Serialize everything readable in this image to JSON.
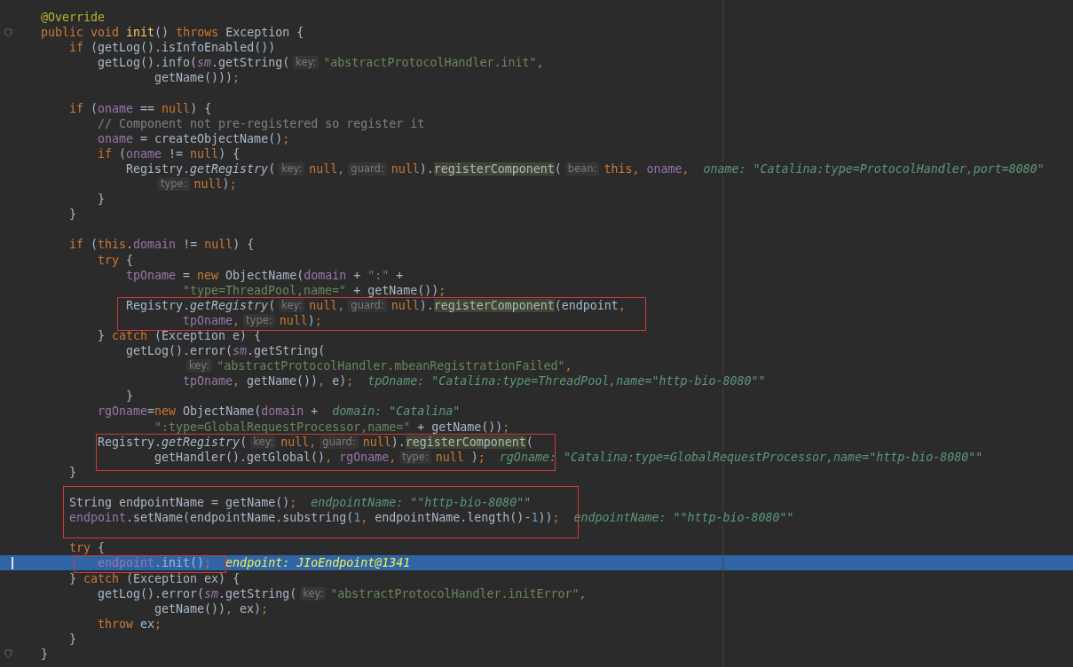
{
  "editor": {
    "lines": [
      {
        "current": false,
        "tokens": [
          {
            "kind": "annotation",
            "text": "@Override"
          }
        ]
      },
      {
        "current": false,
        "fold": true,
        "tokens": [
          {
            "kind": "keyword",
            "text": "public void "
          },
          {
            "kind": "decl",
            "text": "init"
          },
          {
            "kind": "plain",
            "text": "() "
          },
          {
            "kind": "keyword",
            "text": "throws "
          },
          {
            "kind": "plain",
            "text": "Exception {"
          }
        ]
      },
      {
        "current": false,
        "tokens": [
          {
            "kind": "keyword",
            "text": "if"
          },
          {
            "kind": "plain",
            "text": " (getLog().isInfoEnabled())"
          }
        ]
      },
      {
        "current": false,
        "tokens": [
          {
            "kind": "plain",
            "text": "getLog().info("
          },
          {
            "kind": "static_field",
            "text": "sm"
          },
          {
            "kind": "plain",
            "text": ".getString("
          },
          {
            "kind": "hint",
            "text": "key:"
          },
          {
            "kind": "string",
            "text": "\"abstractProtocolHandler.init\""
          },
          {
            "kind": "keyword",
            "text": ","
          }
        ]
      },
      {
        "current": false,
        "tokens": [
          {
            "kind": "plain",
            "text": "getName()))"
          },
          {
            "kind": "keyword",
            "text": ";"
          }
        ]
      },
      {
        "current": false
      },
      {
        "current": false,
        "tokens": [
          {
            "kind": "keyword",
            "text": "if"
          },
          {
            "kind": "plain",
            "text": " ("
          },
          {
            "kind": "field",
            "text": "oname"
          },
          {
            "kind": "plain",
            "text": " == "
          },
          {
            "kind": "keyword",
            "text": "null"
          },
          {
            "kind": "plain",
            "text": ") {"
          }
        ]
      },
      {
        "current": false,
        "tokens": [
          {
            "kind": "comment",
            "text": "// Component not pre-registered so register it"
          }
        ]
      },
      {
        "current": false,
        "tokens": [
          {
            "kind": "field",
            "text": "oname"
          },
          {
            "kind": "plain",
            "text": " = createObjectName()"
          },
          {
            "kind": "keyword",
            "text": ";"
          }
        ]
      },
      {
        "current": false,
        "tokens": [
          {
            "kind": "keyword",
            "text": "if"
          },
          {
            "kind": "plain",
            "text": " ("
          },
          {
            "kind": "field",
            "text": "oname"
          },
          {
            "kind": "plain",
            "text": " != "
          },
          {
            "kind": "keyword",
            "text": "null"
          },
          {
            "kind": "plain",
            "text": ") {"
          }
        ]
      },
      {
        "current": false,
        "tokens": [
          {
            "kind": "plain",
            "text": "Registry."
          },
          {
            "kind": "static_method",
            "text": "getRegistry"
          },
          {
            "kind": "plain",
            "text": "("
          },
          {
            "kind": "hint",
            "text": "key:"
          },
          {
            "kind": "keyword",
            "text": "null,"
          },
          {
            "kind": "hint",
            "text": "guard:"
          },
          {
            "kind": "keyword",
            "text": "null"
          },
          {
            "kind": "plain",
            "text": ")."
          },
          {
            "kind": "match",
            "text": "registerComponent"
          },
          {
            "kind": "plain",
            "text": "("
          },
          {
            "kind": "hint",
            "text": "bean:"
          },
          {
            "kind": "keyword",
            "text": "this, "
          },
          {
            "kind": "field",
            "text": "oname"
          },
          {
            "kind": "keyword",
            "text": ","
          },
          {
            "kind": "debug",
            "text": "oname: \"Catalina:type=ProtocolHandler,port=8080\""
          }
        ]
      },
      {
        "current": false,
        "tokens": [
          {
            "kind": "hint",
            "text": "type:"
          },
          {
            "kind": "keyword",
            "text": "null"
          },
          {
            "kind": "plain",
            "text": ")"
          },
          {
            "kind": "keyword",
            "text": ";"
          }
        ]
      },
      {
        "current": false,
        "tokens": [
          {
            "kind": "plain",
            "text": "}"
          }
        ]
      },
      {
        "current": false,
        "tokens": [
          {
            "kind": "plain",
            "text": "}"
          }
        ]
      },
      {
        "current": false
      },
      {
        "current": false,
        "tokens": [
          {
            "kind": "keyword",
            "text": "if"
          },
          {
            "kind": "plain",
            "text": " ("
          },
          {
            "kind": "keyword",
            "text": "this"
          },
          {
            "kind": "plain",
            "text": "."
          },
          {
            "kind": "field",
            "text": "domain"
          },
          {
            "kind": "plain",
            "text": " != "
          },
          {
            "kind": "keyword",
            "text": "null"
          },
          {
            "kind": "plain",
            "text": ") {"
          }
        ]
      },
      {
        "current": false,
        "tokens": [
          {
            "kind": "keyword",
            "text": "try"
          },
          {
            "kind": "plain",
            "text": " {"
          }
        ]
      },
      {
        "current": false,
        "tokens": [
          {
            "kind": "field",
            "text": "tpOname"
          },
          {
            "kind": "plain",
            "text": " = "
          },
          {
            "kind": "keyword",
            "text": "new "
          },
          {
            "kind": "plain",
            "text": "ObjectName("
          },
          {
            "kind": "field",
            "text": "domain"
          },
          {
            "kind": "plain",
            "text": " + "
          },
          {
            "kind": "string",
            "text": "\":\""
          },
          {
            "kind": "plain",
            "text": " +"
          }
        ]
      },
      {
        "current": false,
        "tokens": [
          {
            "kind": "string",
            "text": "\"type=ThreadPool,name=\""
          },
          {
            "kind": "plain",
            "text": " + getName())"
          },
          {
            "kind": "keyword",
            "text": ";"
          }
        ]
      },
      {
        "current": false,
        "tokens": [
          {
            "kind": "plain",
            "text": "Registry."
          },
          {
            "kind": "static_method",
            "text": "getRegistry"
          },
          {
            "kind": "plain",
            "text": "("
          },
          {
            "kind": "hint",
            "text": "key:"
          },
          {
            "kind": "keyword",
            "text": "null,"
          },
          {
            "kind": "hint",
            "text": "guard:"
          },
          {
            "kind": "keyword",
            "text": "null"
          },
          {
            "kind": "plain",
            "text": ")."
          },
          {
            "kind": "match",
            "text": "registerComponent"
          },
          {
            "kind": "plain",
            "text": "(endpoint"
          },
          {
            "kind": "keyword",
            "text": ","
          }
        ]
      },
      {
        "current": false,
        "tokens": [
          {
            "kind": "field",
            "text": "tpOname"
          },
          {
            "kind": "keyword",
            "text": ","
          },
          {
            "kind": "hint",
            "text": "type:"
          },
          {
            "kind": "keyword",
            "text": "null"
          },
          {
            "kind": "plain",
            "text": ")"
          },
          {
            "kind": "keyword",
            "text": ";"
          }
        ]
      },
      {
        "current": false,
        "tokens": [
          {
            "kind": "plain",
            "text": "} "
          },
          {
            "kind": "keyword",
            "text": "catch"
          },
          {
            "kind": "plain",
            "text": " (Exception e) {"
          }
        ]
      },
      {
        "current": false,
        "tokens": [
          {
            "kind": "plain",
            "text": "getLog().error("
          },
          {
            "kind": "static_field",
            "text": "sm"
          },
          {
            "kind": "plain",
            "text": ".getString("
          }
        ]
      },
      {
        "current": false,
        "tokens": [
          {
            "kind": "hint",
            "text": "key:"
          },
          {
            "kind": "string",
            "text": "\"abstractProtocolHandler.mbeanRegistrationFailed\""
          },
          {
            "kind": "keyword",
            "text": ","
          }
        ]
      },
      {
        "current": false,
        "tokens": [
          {
            "kind": "field",
            "text": "tpOname"
          },
          {
            "kind": "keyword",
            "text": ", "
          },
          {
            "kind": "plain",
            "text": "getName())"
          },
          {
            "kind": "keyword",
            "text": ", "
          },
          {
            "kind": "plain",
            "text": "e)"
          },
          {
            "kind": "keyword",
            "text": ";"
          },
          {
            "kind": "debug",
            "text": "tpOname: \"Catalina:type=ThreadPool,name=\"http-bio-8080\"\""
          }
        ]
      },
      {
        "current": false,
        "tokens": [
          {
            "kind": "plain",
            "text": "}"
          }
        ]
      },
      {
        "current": false,
        "tokens": [
          {
            "kind": "field",
            "text": "rgOname"
          },
          {
            "kind": "plain",
            "text": "="
          },
          {
            "kind": "keyword",
            "text": "new "
          },
          {
            "kind": "plain",
            "text": "ObjectName("
          },
          {
            "kind": "field",
            "text": "domain"
          },
          {
            "kind": "plain",
            "text": " +"
          },
          {
            "kind": "debug",
            "text": "domain: \"Catalina\""
          }
        ]
      },
      {
        "current": false,
        "tokens": [
          {
            "kind": "string",
            "text": "\":type=GlobalRequestProcessor,name=\""
          },
          {
            "kind": "plain",
            "text": " + getName())"
          },
          {
            "kind": "keyword",
            "text": ";"
          }
        ]
      },
      {
        "current": false,
        "tokens": [
          {
            "kind": "plain",
            "text": "Registry."
          },
          {
            "kind": "static_method",
            "text": "getRegistry"
          },
          {
            "kind": "plain",
            "text": "("
          },
          {
            "kind": "hint",
            "text": "key:"
          },
          {
            "kind": "keyword",
            "text": "null,"
          },
          {
            "kind": "hint",
            "text": "guard:"
          },
          {
            "kind": "keyword",
            "text": "null"
          },
          {
            "kind": "plain",
            "text": ")."
          },
          {
            "kind": "match",
            "text": "registerComponent"
          },
          {
            "kind": "plain",
            "text": "("
          }
        ]
      },
      {
        "current": false,
        "tokens": [
          {
            "kind": "plain",
            "text": "getHandler().getGlobal()"
          },
          {
            "kind": "keyword",
            "text": ", "
          },
          {
            "kind": "field",
            "text": "rgOname"
          },
          {
            "kind": "keyword",
            "text": ","
          },
          {
            "kind": "hint",
            "text": "type:"
          },
          {
            "kind": "keyword",
            "text": "null "
          },
          {
            "kind": "plain",
            "text": ")"
          },
          {
            "kind": "keyword",
            "text": ";"
          },
          {
            "kind": "debug",
            "text": "rgOname: \"Catalina:type=GlobalRequestProcessor,name=\"http-bio-8080\"\""
          }
        ]
      },
      {
        "current": false,
        "tokens": [
          {
            "kind": "plain",
            "text": "}"
          }
        ]
      },
      {
        "current": false
      },
      {
        "current": false,
        "tokens": [
          {
            "kind": "plain",
            "text": "String endpointName = getName()"
          },
          {
            "kind": "keyword",
            "text": ";"
          },
          {
            "kind": "debug",
            "text": "endpointName: \"\"http-bio-8080\"\""
          }
        ]
      },
      {
        "current": false,
        "tokens": [
          {
            "kind": "field",
            "text": "endpoint"
          },
          {
            "kind": "plain",
            "text": ".setName(endpointName.substring("
          },
          {
            "kind": "number",
            "text": "1"
          },
          {
            "kind": "keyword",
            "text": ", "
          },
          {
            "kind": "plain",
            "text": "endpointName.length()-"
          },
          {
            "kind": "number",
            "text": "1"
          },
          {
            "kind": "plain",
            "text": "))"
          },
          {
            "kind": "keyword",
            "text": ";"
          },
          {
            "kind": "debug",
            "text": "endpointName: \"\"http-bio-8080\"\""
          }
        ]
      },
      {
        "current": false
      },
      {
        "current": false,
        "tokens": [
          {
            "kind": "keyword",
            "text": "try"
          },
          {
            "kind": "plain",
            "text": " {"
          }
        ]
      },
      {
        "current": true,
        "tokens": [
          {
            "kind": "field",
            "text": "endpoint"
          },
          {
            "kind": "plain",
            "text": ".init()"
          },
          {
            "kind": "keyword",
            "text": ";"
          },
          {
            "kind": "debug",
            "text": "endpoint: JIoEndpoint@1341"
          }
        ]
      },
      {
        "current": false,
        "tokens": [
          {
            "kind": "plain",
            "text": "} "
          },
          {
            "kind": "keyword",
            "text": "catch"
          },
          {
            "kind": "plain",
            "text": " (Exception ex) {"
          }
        ]
      },
      {
        "current": false,
        "tokens": [
          {
            "kind": "plain",
            "text": "getLog().error("
          },
          {
            "kind": "static_field",
            "text": "sm"
          },
          {
            "kind": "plain",
            "text": ".getString("
          },
          {
            "kind": "hint",
            "text": "key:"
          },
          {
            "kind": "string",
            "text": "\"abstractProtocolHandler.initError\""
          },
          {
            "kind": "keyword",
            "text": ","
          }
        ]
      },
      {
        "current": false,
        "tokens": [
          {
            "kind": "plain",
            "text": "getName())"
          },
          {
            "kind": "keyword",
            "text": ", "
          },
          {
            "kind": "plain",
            "text": "ex)"
          },
          {
            "kind": "keyword",
            "text": ";"
          }
        ]
      },
      {
        "current": false,
        "tokens": [
          {
            "kind": "keyword",
            "text": "throw "
          },
          {
            "kind": "plain",
            "text": "ex"
          },
          {
            "kind": "keyword",
            "text": ";"
          }
        ]
      },
      {
        "current": false,
        "tokens": [
          {
            "kind": "plain",
            "text": "}"
          }
        ]
      },
      {
        "current": false,
        "fold": true,
        "tokens": [
          {
            "kind": "plain",
            "text": "}"
          }
        ]
      }
    ]
  }
}
